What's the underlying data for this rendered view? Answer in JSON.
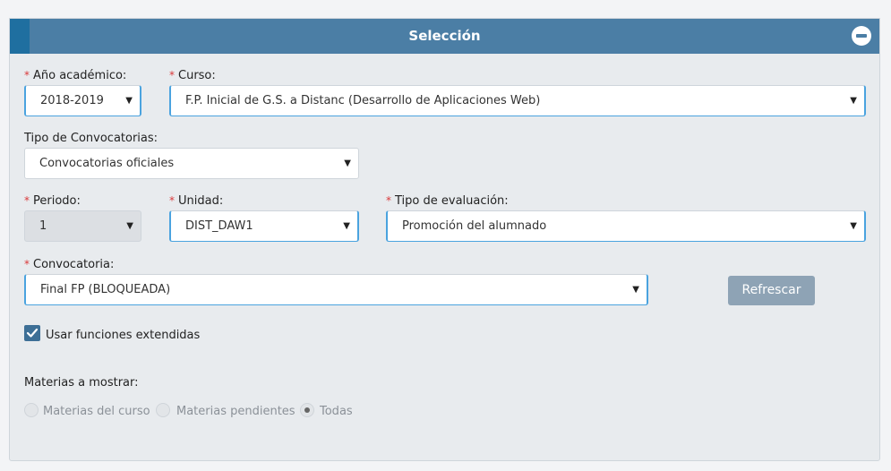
{
  "panel": {
    "title": "Selección"
  },
  "fields": {
    "anio": {
      "required": "*",
      "label": "Año académico:",
      "value": "2018-2019"
    },
    "curso": {
      "required": "*",
      "label": "Curso:",
      "value": "F.P. Inicial de G.S. a Distanc (Desarrollo de Aplicaciones Web)"
    },
    "tipo_convocatorias": {
      "label": "Tipo de Convocatorias:",
      "value": "Convocatorias oficiales"
    },
    "periodo": {
      "required": "*",
      "label": "Periodo:",
      "value": "1"
    },
    "unidad": {
      "required": "*",
      "label": "Unidad:",
      "value": "DIST_DAW1"
    },
    "tipo_evaluacion": {
      "required": "*",
      "label": "Tipo de evaluación:",
      "value": "Promoción del alumnado"
    },
    "convocatoria": {
      "required": "*",
      "label": "Convocatoria:",
      "value": "Final FP (BLOQUEADA)"
    }
  },
  "arrow": "▼",
  "refresh_button": "Refrescar",
  "extended_functions": {
    "label": "Usar funciones extendidas",
    "checked": true
  },
  "materias": {
    "label": "Materias a mostrar:",
    "options": [
      {
        "label": "Materias del curso",
        "checked": false
      },
      {
        "label": "Materias pendientes",
        "checked": false
      },
      {
        "label": "Todas",
        "checked": true
      }
    ]
  },
  "colors": {
    "header": "#4b7ea5",
    "header_accent": "#1f6fa0",
    "required": "#d9383a",
    "focus_border": "#4aa3df",
    "button": "#8ea3b5",
    "checkbox": "#3d6f96"
  },
  "icons": {
    "collapse": "minus-circle-icon",
    "check": "check-icon",
    "dropdown": "triangle-down-icon"
  }
}
